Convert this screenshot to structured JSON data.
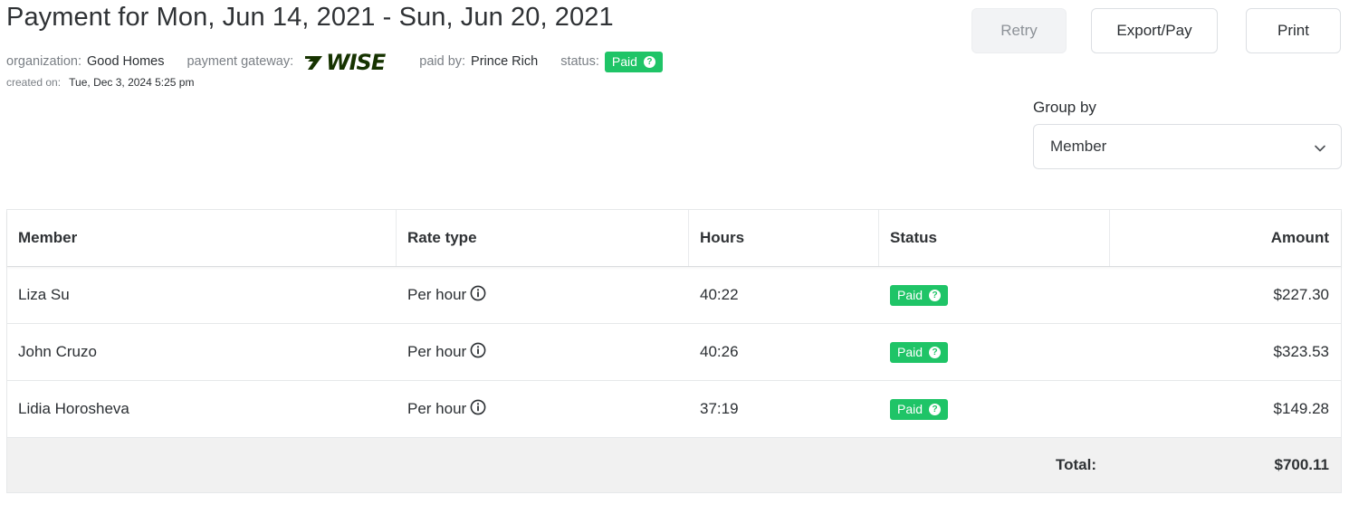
{
  "header": {
    "title": "Payment for Mon, Jun 14, 2021 - Sun, Jun 20, 2021",
    "organization_label": "organization:",
    "organization_value": "Good Homes",
    "gateway_label": "payment gateway:",
    "gateway_logo_text": "WISE",
    "paid_by_label": "paid by:",
    "paid_by_value": "Prince Rich",
    "status_label": "status:",
    "status_value": "Paid",
    "created_label": "created on:",
    "created_value": "Tue, Dec 3, 2024 5:25 pm"
  },
  "toolbar": {
    "retry_label": "Retry",
    "export_label": "Export/Pay",
    "print_label": "Print"
  },
  "group_by": {
    "label": "Group by",
    "selected": "Member"
  },
  "table": {
    "columns": [
      "Member",
      "Rate type",
      "Hours",
      "Status",
      "Amount"
    ],
    "rows": [
      {
        "member": "Liza Su",
        "rate_type": "Per hour",
        "hours": "40:22",
        "status": "Paid",
        "amount": "$227.30"
      },
      {
        "member": "John Cruzo",
        "rate_type": "Per hour",
        "hours": "40:26",
        "status": "Paid",
        "amount": "$323.53"
      },
      {
        "member": "Lidia Horosheva",
        "rate_type": "Per hour",
        "hours": "37:19",
        "status": "Paid",
        "amount": "$149.28"
      }
    ],
    "total_label": "Total:",
    "total_value": "$700.11"
  },
  "colors": {
    "paid_badge": "#1fc467",
    "wise_logo": "#163300",
    "total_row_bg": "#f1f1f1"
  },
  "icons": {
    "info": "info-circle-icon",
    "status_help": "question-circle-icon",
    "select_arrow": "chevron-down-icon",
    "gateway": "wise-logo-icon"
  }
}
